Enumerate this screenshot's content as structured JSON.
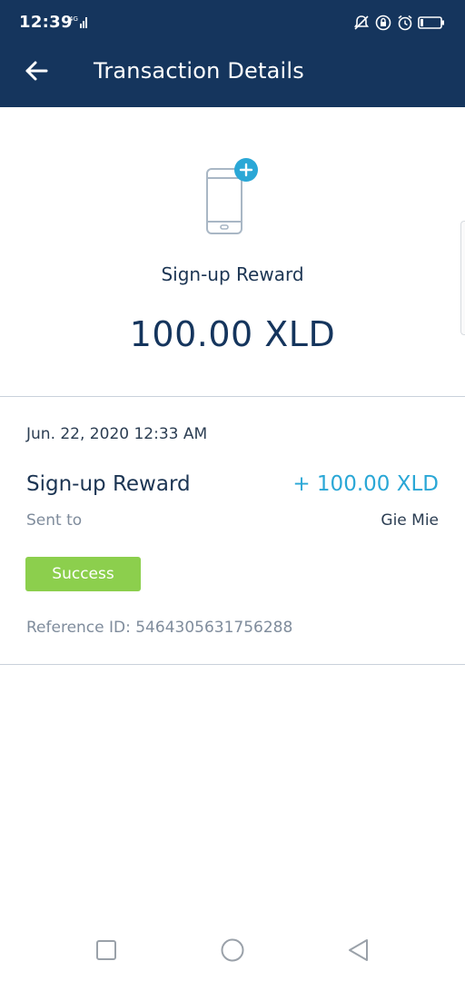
{
  "status_bar": {
    "time": "12:39",
    "network": "4G",
    "icons": [
      "mute-icon",
      "location-lock-icon",
      "alarm-icon",
      "battery-icon"
    ]
  },
  "header": {
    "title": "Transaction Details",
    "back_icon": "arrow-left-icon"
  },
  "hero": {
    "icon": "phone-plus-icon",
    "title": "Sign-up Reward",
    "amount": "100.00 XLD"
  },
  "details": {
    "date": "Jun. 22, 2020 12:33 AM",
    "type": "Sign-up Reward",
    "amount": "+ 100.00 XLD",
    "sent_to_label": "Sent to",
    "sent_to_value": "Gie Mie",
    "status": "Success",
    "reference": "Reference ID: 5464305631756288"
  },
  "nav_bar": {
    "icons": [
      "recent-apps-icon",
      "home-icon",
      "back-icon"
    ]
  },
  "colors": {
    "header_bg": "#15355d",
    "amount_accent": "#2aa7d6",
    "success_badge": "#8ccf4d",
    "muted_text": "#7f8c9c"
  }
}
